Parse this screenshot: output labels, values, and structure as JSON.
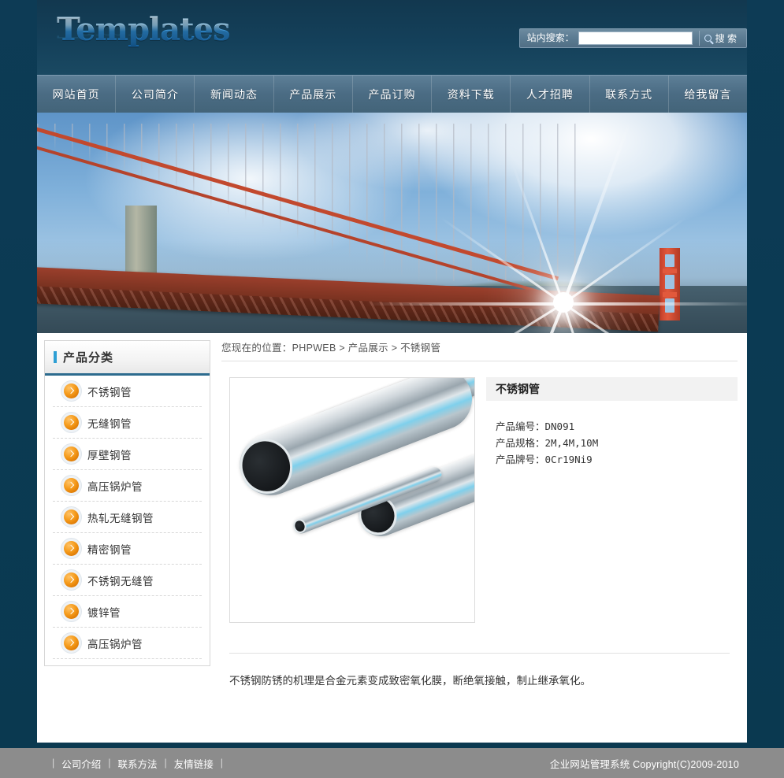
{
  "site": {
    "logo_text": "Templates",
    "background_color": "#0a3a54",
    "accent_color": "#2e9fd4",
    "nav_color": "#4b6c84"
  },
  "search": {
    "label": "站内搜索：",
    "value": "",
    "placeholder": "",
    "button_label": "搜 索",
    "icon": "search-icon"
  },
  "nav": {
    "items": [
      {
        "label": "网站首页"
      },
      {
        "label": "公司简介"
      },
      {
        "label": "新闻动态"
      },
      {
        "label": "产品展示"
      },
      {
        "label": "产品订购"
      },
      {
        "label": "资料下载"
      },
      {
        "label": "人才招聘"
      },
      {
        "label": "联系方式"
      },
      {
        "label": "给我留言"
      }
    ]
  },
  "banner": {
    "alt": "金门大桥 banner"
  },
  "sidebar": {
    "title": "产品分类",
    "items": [
      {
        "label": "不锈钢管"
      },
      {
        "label": "无缝钢管"
      },
      {
        "label": "厚壁钢管"
      },
      {
        "label": "高压锅炉管"
      },
      {
        "label": "热轧无缝钢管"
      },
      {
        "label": "精密钢管"
      },
      {
        "label": "不锈钢无缝管"
      },
      {
        "label": "镀锌管"
      },
      {
        "label": "高压锅炉管"
      }
    ]
  },
  "main": {
    "breadcrumb": "您现在的位置：PHPWEB > 产品展示 > 不锈钢管",
    "product": {
      "image_alt": "不锈钢管产品图片",
      "title": "不锈钢管",
      "code_line": "产品编号：DN091",
      "spec_line": "产品规格：2M,4M,10M",
      "brand_line": "产品牌号：0Cr19Ni9",
      "description": "不锈钢防锈的机理是合金元素变成致密氧化膜，断绝氧接触，制止继承氧化。"
    }
  },
  "footer": {
    "links": [
      {
        "label": "公司介绍"
      },
      {
        "label": "联系方法"
      },
      {
        "label": "友情链接"
      }
    ],
    "copyright": "企业网站管理系统  Copyright(C)2009-2010"
  }
}
